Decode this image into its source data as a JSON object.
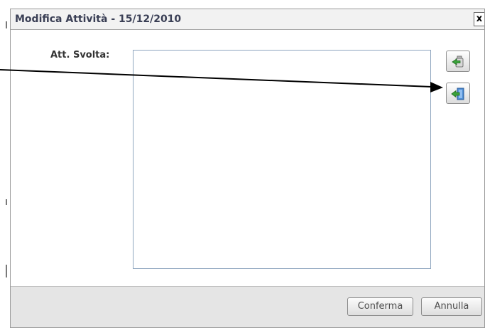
{
  "dialog": {
    "title": "Modifica Attività - 15/12/2010",
    "close_label": "x"
  },
  "form": {
    "label": "Att. Svolta:",
    "value": ""
  },
  "toolbar": {
    "icons": [
      "recycle-icon",
      "import-icon"
    ]
  },
  "footer": {
    "confirm_label": "Conferma",
    "cancel_label": "Annulla"
  }
}
